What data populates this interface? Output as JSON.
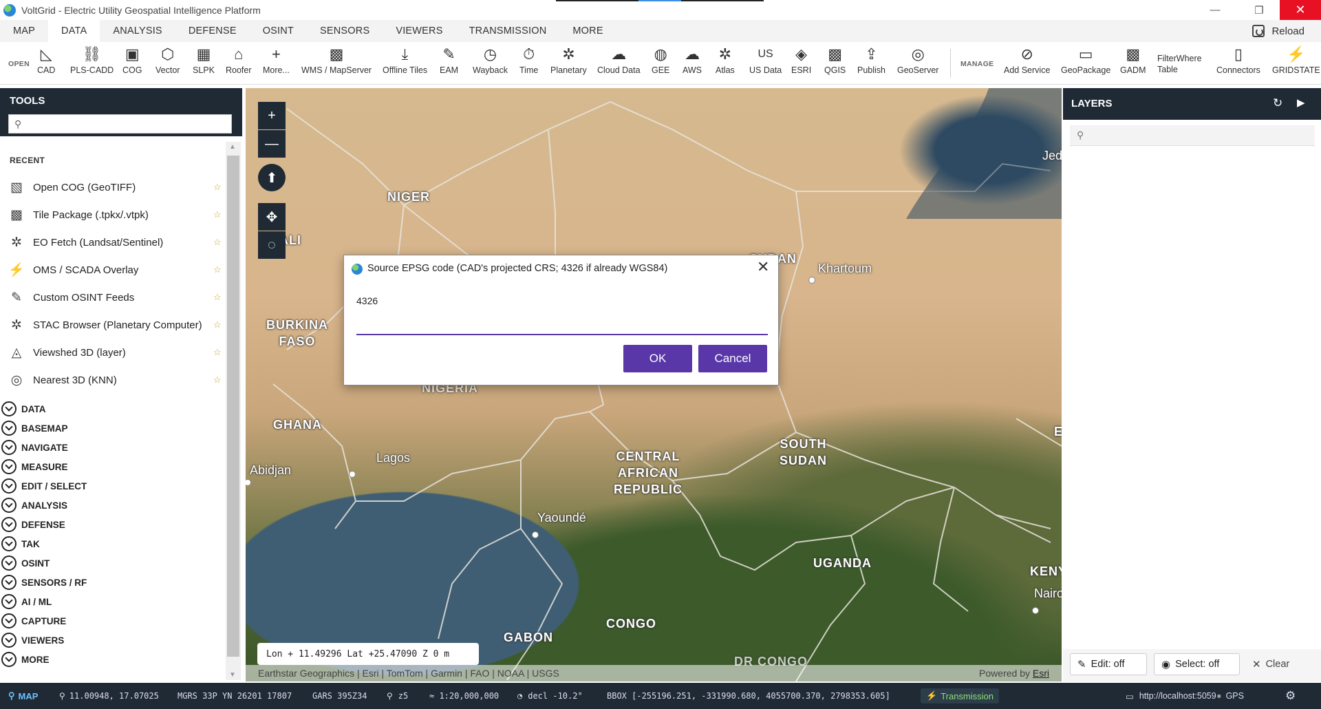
{
  "window": {
    "title": "VoltGrid - Electric Utility Geospatial Intelligence Platform",
    "minimize": "—",
    "maximize": "❐",
    "close": "✕"
  },
  "menu": {
    "items": [
      "MAP",
      "DATA",
      "ANALYSIS",
      "DEFENSE",
      "OSINT",
      "SENSORS",
      "VIEWERS",
      "TRANSMISSION",
      "MORE"
    ],
    "active": "DATA",
    "reload": "Reload"
  },
  "ribbon": {
    "open_label": "OPEN",
    "manage_label": "MANAGE",
    "buttons": [
      {
        "label": "CAD",
        "icon": "◺"
      },
      {
        "label": "PLS-CADD",
        "icon": "⛓"
      },
      {
        "label": "COG",
        "icon": "▣"
      },
      {
        "label": "Vector",
        "icon": "⬡"
      },
      {
        "label": "SLPK",
        "icon": "▦"
      },
      {
        "label": "Roofer",
        "icon": "⌂"
      },
      {
        "label": "More...",
        "icon": "+"
      },
      {
        "label": "WMS / MapServer",
        "icon": "▩"
      },
      {
        "label": "Offline Tiles",
        "icon": "⤓"
      },
      {
        "label": "EAM",
        "icon": "✎"
      },
      {
        "label": "Wayback",
        "icon": "◷"
      },
      {
        "label": "Time",
        "icon": "⏱"
      },
      {
        "label": "Planetary",
        "icon": "✲"
      },
      {
        "label": "Cloud Data",
        "icon": "☁"
      },
      {
        "label": "GEE",
        "icon": "◍"
      },
      {
        "label": "AWS",
        "icon": "☁"
      },
      {
        "label": "Atlas",
        "icon": "✲"
      },
      {
        "label": "US Data",
        "icon": "US"
      },
      {
        "label": "ESRI",
        "icon": "◈"
      },
      {
        "label": "QGIS",
        "icon": "▩"
      },
      {
        "label": "Publish",
        "icon": "⇪"
      },
      {
        "label": "GeoServer",
        "icon": "◎"
      },
      {
        "label": "Add Service",
        "icon": "⊘"
      },
      {
        "label": "GeoPackage",
        "icon": "▭"
      },
      {
        "label": "GADM",
        "icon": "▩"
      },
      {
        "label": "Connectors",
        "icon": "▯"
      },
      {
        "label": "GRIDSTATE",
        "icon": "⚡"
      }
    ],
    "filterwhere_line1": "FilterWhere",
    "filterwhere_line2": "Table"
  },
  "tools": {
    "title": "TOOLS",
    "search_placeholder": "",
    "recent_label": "RECENT",
    "recent": [
      {
        "label": "Open COG (GeoTIFF)",
        "icon": "▧"
      },
      {
        "label": "Tile Package (.tpkx/.vtpk)",
        "icon": "▩"
      },
      {
        "label": "EO Fetch (Landsat/Sentinel)",
        "icon": "✲"
      },
      {
        "label": "OMS / SCADA Overlay",
        "icon": "⚡"
      },
      {
        "label": "Custom OSINT Feeds",
        "icon": "✎"
      },
      {
        "label": "STAC Browser (Planetary Computer)",
        "icon": "✲"
      },
      {
        "label": "Viewshed 3D (layer)",
        "icon": "◬"
      },
      {
        "label": "Nearest 3D (KNN)",
        "icon": "◎"
      }
    ],
    "star": "☆",
    "categories": [
      "DATA",
      "BASEMAP",
      "NAVIGATE",
      "MEASURE",
      "EDIT / SELECT",
      "ANALYSIS",
      "DEFENSE",
      "TAK",
      "OSINT",
      "SENSORS / RF",
      "AI / ML",
      "CAPTURE",
      "VIEWERS",
      "MORE"
    ]
  },
  "map": {
    "labels": {
      "niger": "NIGER",
      "sudan": "SUDAN",
      "burkina": "BURKINA\nFASO",
      "mali": "ALI",
      "nigeria": "NIGERIA",
      "ghana": "GHANA",
      "car": "CENTRAL\nAFRICAN\nREPUBLIC",
      "south_sudan": "SOUTH\nSUDAN",
      "uganda": "UGANDA",
      "kenya": "KENY",
      "gabon": "GABON",
      "congo": "CONGO",
      "drc": "DR CONGO",
      "jeddah": "Jed",
      "edge_e": "E"
    },
    "cities": {
      "khartoum": "Khartoum",
      "lagos": "Lagos",
      "abidjan": "Abidjan",
      "yaounde": "Yaoundé",
      "nairobi": "Nairo"
    },
    "controls": {
      "zoom_in": "+",
      "zoom_out": "—",
      "compass": "⬆",
      "pan": "✥",
      "rotate": "◌"
    },
    "coord_readout": "Lon + 11.49296  Lat +25.47090  Z 0 m",
    "attribution": "Earthstar Geographics | Esri | TomTom | Garmin | FAO | NOAA | USGS",
    "powered_by": "Powered by",
    "powered_brand": "Esri"
  },
  "dialog": {
    "title": "Source EPSG code (CAD's projected CRS; 4326 if already WGS84)",
    "prompt": "4326",
    "value": "",
    "ok": "OK",
    "cancel": "Cancel",
    "close": "✕"
  },
  "layers": {
    "title": "LAYERS",
    "refresh": "↻",
    "play": "▶",
    "search_placeholder": "",
    "edit": "Edit: off",
    "select": "Select: off",
    "clear": "Clear"
  },
  "status": {
    "map": "MAP",
    "latlon": "11.00948, 17.07025",
    "mgrs": "MGRS 33P YN 26201 17807",
    "gars": "GARS 395Z34",
    "zoom": "z5",
    "scale": "≈ 1:20,000,000",
    "decl": "decl -10.2°",
    "bbox": "BBOX [-255196.251, -331990.680, 4055700.370, 2798353.605]",
    "transmission": "Transmission",
    "url": "http://localhost:5059",
    "gps": "GPS"
  },
  "colors": {
    "panel_dark": "#1f2a35",
    "accent_purple": "#5a37a8",
    "close_red": "#e81123",
    "status_green": "#8fe07a"
  }
}
